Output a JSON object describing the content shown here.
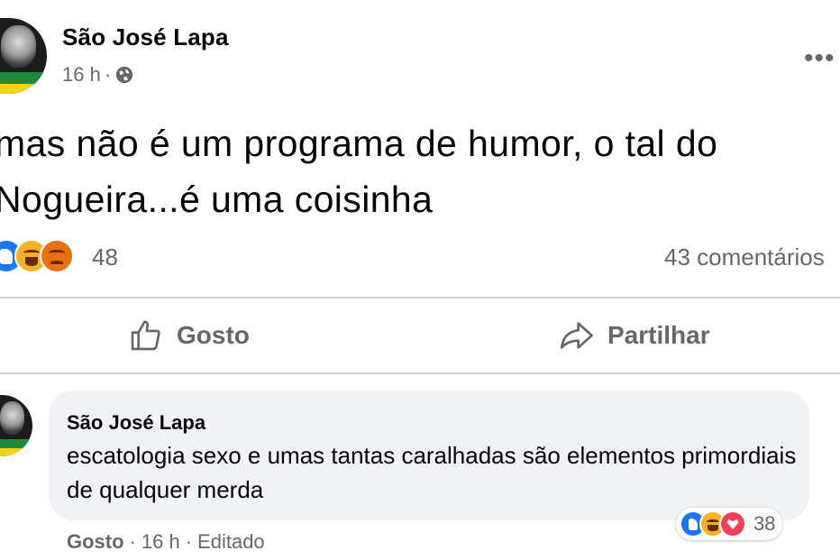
{
  "post": {
    "author": "São José Lapa",
    "time": "16 h",
    "separator": "·",
    "audience_icon": "globe-icon",
    "more_icon": "more-options-icon",
    "more_text": "•••",
    "text_line1": "mas não é um programa de humor, o tal do",
    "text_line2": "Nogueira...é uma coisinha",
    "reaction_icons": [
      "like-reaction-icon",
      "haha-reaction-icon",
      "angry-reaction-icon"
    ],
    "reaction_count": "48",
    "comments_count": "43 comentários"
  },
  "actions": {
    "like_label": "Gosto",
    "share_label": "Partilhar"
  },
  "comment": {
    "author": "São José Lapa",
    "text": "escatologia sexo e umas tantas caralhadas são elementos primordiais de qualquer merda",
    "reaction_icons": [
      "like-reaction-icon",
      "haha-reaction-icon",
      "love-reaction-icon"
    ],
    "reaction_count": "38",
    "like_label": "Gosto",
    "separator": "·",
    "time": "16 h",
    "edited": "Editado"
  },
  "colors": {
    "text_primary": "#050505",
    "text_secondary": "#65676b",
    "bubble": "#f0f2f5",
    "like_blue": "#1877f2",
    "haha_yellow": "#f7b125",
    "angry_orange": "#e9710f",
    "love_red": "#f33e58",
    "divider": "#ced0d4"
  }
}
